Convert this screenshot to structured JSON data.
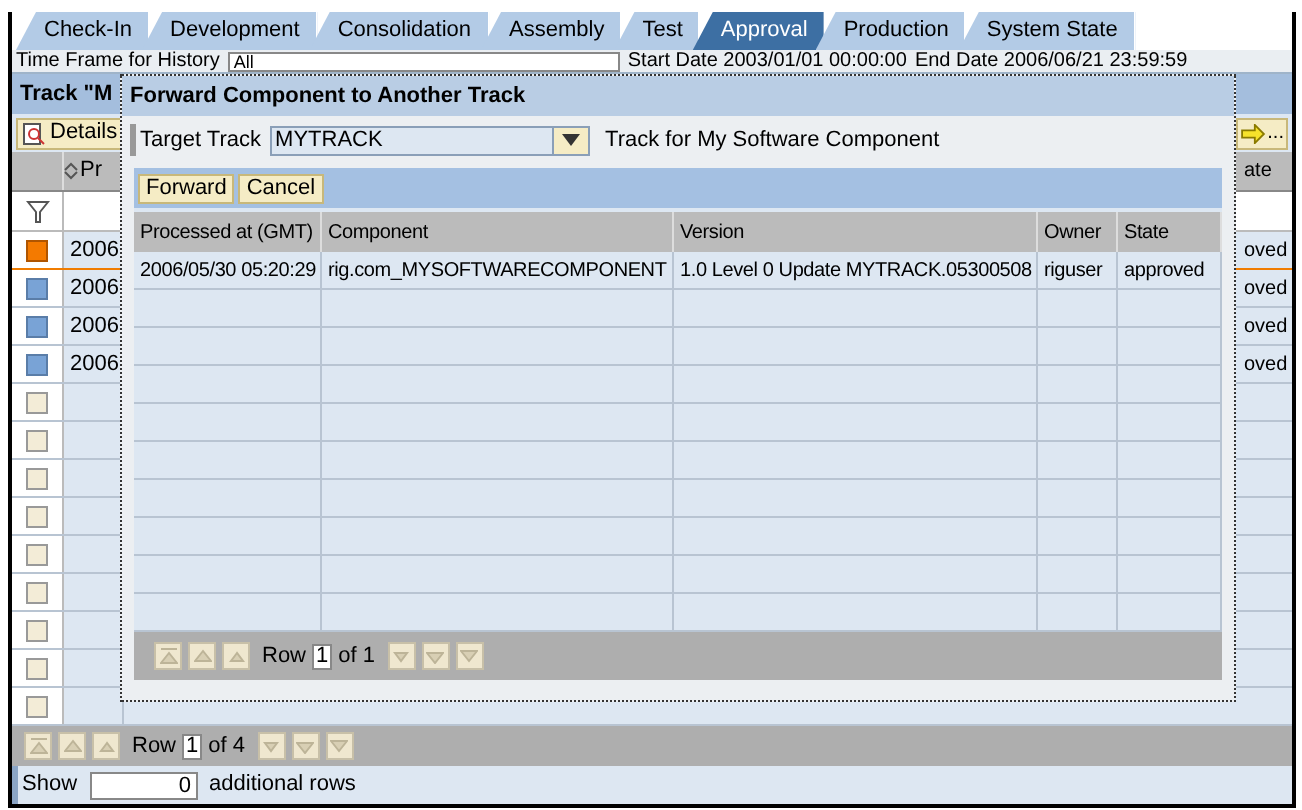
{
  "tabs": [
    {
      "label": "Check-In",
      "selected": false
    },
    {
      "label": "Development",
      "selected": false
    },
    {
      "label": "Consolidation",
      "selected": false
    },
    {
      "label": "Assembly",
      "selected": false
    },
    {
      "label": "Test",
      "selected": false
    },
    {
      "label": "Approval",
      "selected": true
    },
    {
      "label": "Production",
      "selected": false
    },
    {
      "label": "System State",
      "selected": false
    }
  ],
  "filter_bar": {
    "label": "Time Frame for History",
    "value": "All",
    "start_date": "Start Date 2003/01/01 00:00:00",
    "end_date": "End Date 2006/06/21 23:59:59"
  },
  "track_header": "Track \"M",
  "toolbar": {
    "details": "Details",
    "forward_icon_text": "..."
  },
  "table": {
    "column_2": "Pr",
    "column_last": "ate",
    "rows": [
      {
        "kind": "data",
        "selected": true,
        "column_2": "2006",
        "column_last": "oved"
      },
      {
        "kind": "data",
        "selected": false,
        "column_2": "2006",
        "column_last": "oved"
      },
      {
        "kind": "data",
        "selected": false,
        "column_2": "2006",
        "column_last": "oved"
      },
      {
        "kind": "data",
        "selected": false,
        "column_2": "2006",
        "column_last": "oved"
      },
      {
        "kind": "empty",
        "selected": false
      },
      {
        "kind": "empty",
        "selected": false
      },
      {
        "kind": "empty",
        "selected": false
      },
      {
        "kind": "empty",
        "selected": false
      },
      {
        "kind": "empty",
        "selected": false
      },
      {
        "kind": "empty",
        "selected": false
      },
      {
        "kind": "empty",
        "selected": false
      },
      {
        "kind": "empty",
        "selected": false
      },
      {
        "kind": "empty",
        "selected": false
      }
    ],
    "pager": {
      "label": "Row",
      "value": "1",
      "total": "of 4"
    }
  },
  "show_bar": {
    "label": "Show",
    "value": "0",
    "suffix": "additional rows"
  },
  "dialog": {
    "title": "Forward Component to Another Track",
    "target_label": "Target Track",
    "target_value": "MYTRACK",
    "target_description": "Track for My Software Component",
    "buttons": [
      "Forward",
      "Cancel"
    ],
    "columns": [
      "Processed at (GMT)",
      "Component",
      "Version",
      "Owner",
      "State"
    ],
    "rows": [
      {
        "kind": "data",
        "cells": [
          "2006/05/30 05:20:29",
          "rig.com_MYSOFTWARECOMPONENT",
          "1.0 Level 0 Update MYTRACK.05300508",
          "riguser",
          "approved"
        ]
      },
      {
        "kind": "empty"
      },
      {
        "kind": "empty"
      },
      {
        "kind": "empty"
      },
      {
        "kind": "empty"
      },
      {
        "kind": "empty"
      },
      {
        "kind": "empty"
      },
      {
        "kind": "empty"
      },
      {
        "kind": "empty"
      },
      {
        "kind": "empty"
      }
    ],
    "pager": {
      "label": "Row",
      "value": "1",
      "total": "of 1"
    }
  }
}
